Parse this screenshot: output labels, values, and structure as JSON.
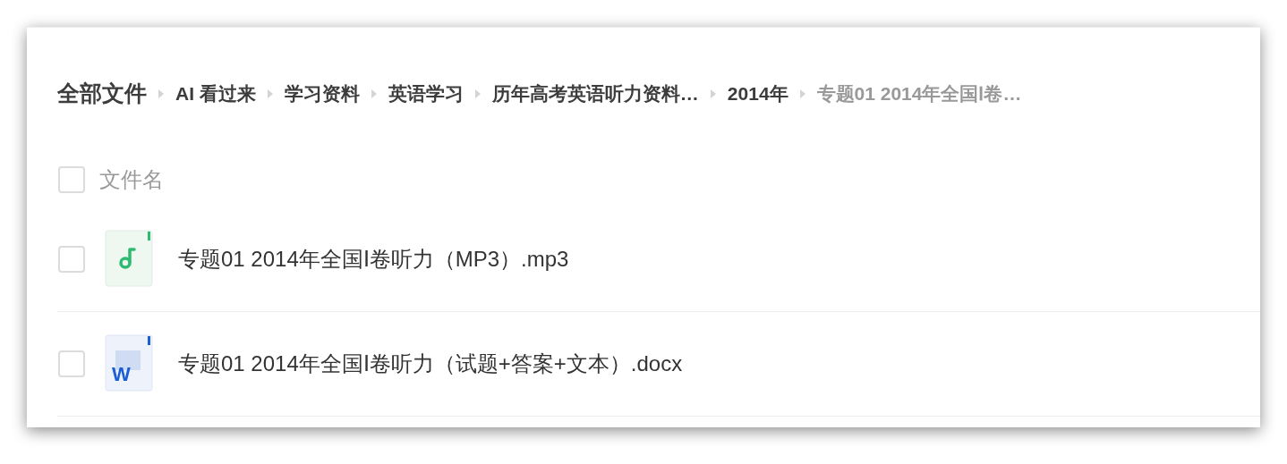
{
  "breadcrumb": [
    {
      "label": "全部文件",
      "kind": "root",
      "current": false
    },
    {
      "label": "AI 看过来",
      "kind": "folder",
      "current": false
    },
    {
      "label": "学习资料",
      "kind": "folder",
      "current": false
    },
    {
      "label": "英语学习",
      "kind": "folder",
      "current": false
    },
    {
      "label": "历年高考英语听力资料…",
      "kind": "folder",
      "current": false
    },
    {
      "label": "2014年",
      "kind": "folder",
      "current": false
    },
    {
      "label": "专题01 2014年全国Ⅰ卷…",
      "kind": "folder",
      "current": true
    }
  ],
  "table": {
    "header": {
      "label": "文件名",
      "checked": false
    },
    "rows": [
      {
        "name": "专题01 2014年全国Ⅰ卷听力（MP3）.mp3",
        "kind": "audio",
        "checked": false
      },
      {
        "name": "专题01 2014年全国Ⅰ卷听力（试题+答案+文本）.docx",
        "kind": "word",
        "icon_letter": "W",
        "checked": false
      }
    ]
  }
}
